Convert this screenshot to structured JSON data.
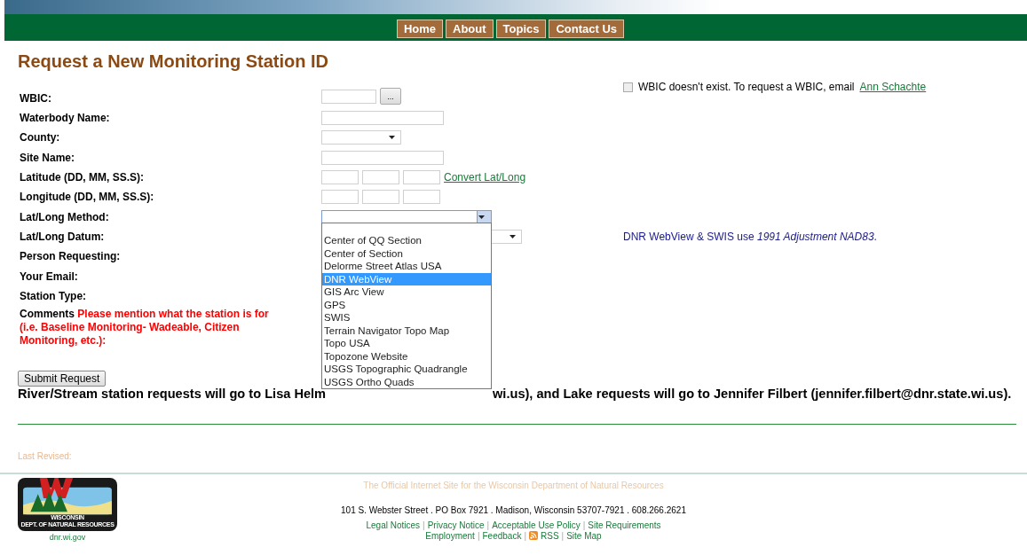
{
  "nav": [
    {
      "label": "Home"
    },
    {
      "label": "About"
    },
    {
      "label": "Topics"
    },
    {
      "label": "Contact Us"
    }
  ],
  "title": "Request a New Monitoring Station ID",
  "form": [
    {
      "label": "WBIC:",
      "kind": "wbic"
    },
    {
      "label": "Waterbody Name:",
      "kind": "text"
    },
    {
      "label": "County:",
      "kind": "select"
    },
    {
      "label": "Site Name:",
      "kind": "text"
    },
    {
      "label": "Latitude (DD, MM, SS.S):",
      "kind": "coords",
      "link": "Convert Lat/Long"
    },
    {
      "label": "Longitude (DD, MM, SS.S):",
      "kind": "coords"
    },
    {
      "label": "Lat/Long Method:",
      "kind": "method"
    },
    {
      "label": "Lat/Long Datum:",
      "kind": "datum"
    },
    {
      "label": "Person Requesting:",
      "kind": "hidden"
    },
    {
      "label": "Your Email:",
      "kind": "hidden"
    },
    {
      "label": "Station Type:",
      "kind": "hidden"
    },
    {
      "label": "Comments",
      "note": "Please mention what the station is for (i.e. Baseline Monitoring- Wadeable, Citizen Monitoring, etc.):",
      "kind": "comments"
    }
  ],
  "wbic_missing": {
    "checked": false,
    "text": "WBIC doesn't exist. To request a WBIC, email",
    "link": "Ann Schachte"
  },
  "datum_note": {
    "text": "DNR WebView & SWIS use",
    "emphasis": "1991 Adjustment NAD83",
    "end": "."
  },
  "method_options": [
    {
      "label": "Center of QQ Section",
      "selected": false
    },
    {
      "label": "Center of Section",
      "selected": false
    },
    {
      "label": "Delorme Street Atlas USA",
      "selected": false
    },
    {
      "label": "DNR WebView",
      "selected": true
    },
    {
      "label": "GIS Arc View",
      "selected": false
    },
    {
      "label": "GPS",
      "selected": false
    },
    {
      "label": "SWIS",
      "selected": false
    },
    {
      "label": "Terrain Navigator Topo Map",
      "selected": false
    },
    {
      "label": "Topo USA",
      "selected": false
    },
    {
      "label": "Topozone Website",
      "selected": false
    },
    {
      "label": "USGS Topographic Quadrangle",
      "selected": false
    },
    {
      "label": "USGS Ortho Quads",
      "selected": false
    }
  ],
  "lookup_label": "...",
  "submit": "Submit Request",
  "routing_text": [
    "River/Stream station requests will go to Lisa Helm",
    "wi.us), and Lake requests will go to Jennifer Filbert (jennifer.filbert@dnr.state.wi.us)."
  ],
  "last_revised": "Last Revised:",
  "footer": {
    "official": "The Official Internet Site for the Wisconsin Department of Natural Resources",
    "address": "101 S. Webster Street . PO Box 7921 . Madison, Wisconsin 53707-7921 . 608.266.2621",
    "links_1": [
      "Legal Notices",
      "Privacy Notice",
      "Acceptable Use Policy",
      "Site Requirements"
    ],
    "links_2": [
      "Employment",
      "Feedback",
      "RSS",
      "Site Map"
    ],
    "logo_text": [
      "WISCONSIN",
      "DEPT. OF NATURAL RESOURCES"
    ],
    "site": "dnr.wi.gov",
    "separator": "|"
  }
}
